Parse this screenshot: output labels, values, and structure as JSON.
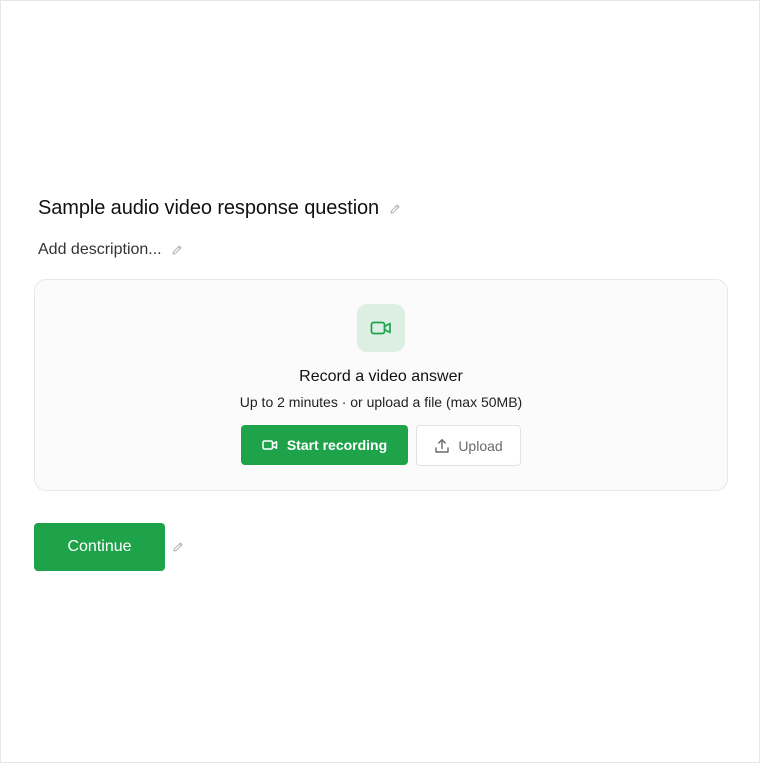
{
  "question": {
    "title": "Sample audio video response question",
    "description": "Add description..."
  },
  "recorder": {
    "heading": "Record a video answer",
    "subtext": "Up to 2 minutes · or upload a file (max 50MB)",
    "record_label": "Start recording",
    "upload_label": "Upload",
    "icon": "video-camera-icon"
  },
  "actions": {
    "continue_label": "Continue"
  },
  "colors": {
    "accent": "#1ea34b",
    "icon_badge_bg": "#dcefe2",
    "edit_icon": "#b8b8b8"
  }
}
